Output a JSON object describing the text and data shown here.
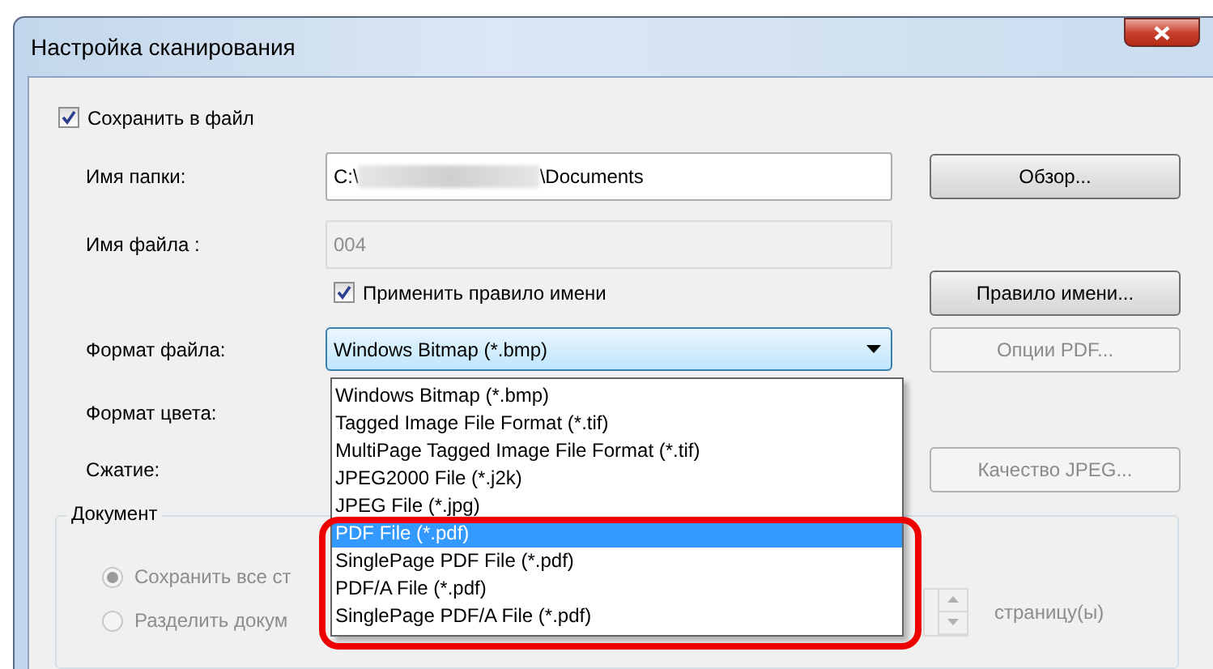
{
  "window": {
    "title": "Настройка сканирования"
  },
  "save_to_file": {
    "label": "Сохранить в файл",
    "checked": true
  },
  "folder": {
    "label": "Имя папки:",
    "value_start": "C:\\",
    "value_end": "\\Documents"
  },
  "file_name": {
    "label": "Имя файла :",
    "value": "004",
    "disabled": true
  },
  "apply_rule": {
    "label": "Применить правило имени",
    "checked": true
  },
  "buttons": {
    "browse": {
      "label": "Обзор...",
      "disabled": false
    },
    "name_rule": {
      "label": "Правило имени...",
      "disabled": false
    },
    "pdf_options": {
      "label": "Опции PDF...",
      "disabled": true
    },
    "jpeg_quality": {
      "label": "Качество JPEG...",
      "disabled": true
    }
  },
  "file_format": {
    "label": "Формат файла:",
    "value": "Windows Bitmap (*.bmp)",
    "expanded": true,
    "options": [
      {
        "label": "Windows Bitmap (*.bmp)",
        "highlighted": false
      },
      {
        "label": "Tagged Image File Format (*.tif)",
        "highlighted": false
      },
      {
        "label": "MultiPage Tagged Image File Format (*.tif)",
        "highlighted": false
      },
      {
        "label": "JPEG2000 File (*.j2k)",
        "highlighted": false
      },
      {
        "label": "JPEG File (*.jpg)",
        "highlighted": false
      },
      {
        "label": "PDF File (*.pdf)",
        "highlighted": true
      },
      {
        "label": "SinglePage PDF File (*.pdf)",
        "highlighted": false
      },
      {
        "label": "PDF/A File (*.pdf)",
        "highlighted": false
      },
      {
        "label": "SinglePage PDF/A File (*.pdf)",
        "highlighted": false
      }
    ]
  },
  "color_format": {
    "label": "Формат цвета:"
  },
  "compression": {
    "label": "Сжатие:"
  },
  "document": {
    "title": "Документ",
    "options": [
      {
        "label": "Сохранить все ст",
        "selected": true,
        "disabled": true
      },
      {
        "label": "Разделить докум",
        "selected": false,
        "disabled": true
      }
    ],
    "pages_unit": "страницу(ы)"
  }
}
